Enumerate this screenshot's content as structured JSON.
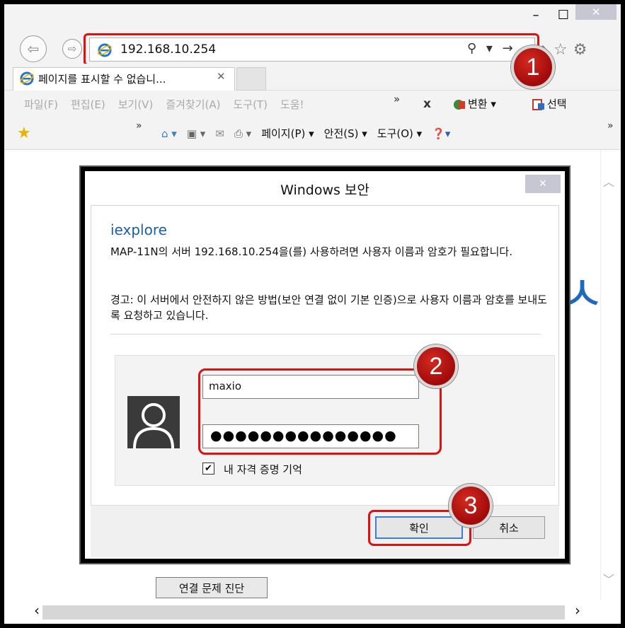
{
  "window": {
    "minimize_glyph": "–",
    "maximize_glyph": "☐",
    "close_glyph": "✕"
  },
  "addressbar": {
    "url": "192.168.10.254",
    "tools": "⚲ ▾ →"
  },
  "right_icons": "⌂☆⚙",
  "tab": {
    "title": "페이지를 표시할 수 없습니...",
    "close_glyph": "✕"
  },
  "menu": {
    "items": [
      "파일(F)",
      "편집(E)",
      "보기(V)",
      "즐겨찾기(A)",
      "도구(T)",
      "도움!"
    ],
    "more": "»",
    "x": "x",
    "convert": "변환 ▾",
    "select": "선택"
  },
  "commandbar": {
    "more": "»",
    "home": "⌂ ▾",
    "feeds": "▣ ▾",
    "mail": "✉",
    "print": "⎙ ▾",
    "page": "페이지(P) ▾",
    "safety": "안전(S) ▾",
    "tools": "도구(O) ▾",
    "help": "❓▾"
  },
  "background": {
    "glyph": "ㅅ|",
    "diagnose_button": "연결 문제 진단"
  },
  "dialog": {
    "title": "Windows 보안",
    "close_glyph": "✕",
    "app_name": "iexplore",
    "message": "MAP-11N의 서버 192.168.10.254을(를) 사용하려면 사용자 이름과 암호가 필요합니다.",
    "warning": "경고: 이 서버에서 안전하지 않은 방법(보안 연결 없이 기본 인증)으로 사용자 이름과 암호를 보내도록 요청하고 있습니다.",
    "username": "maxio",
    "password_mask": "●●●●●●●●●●●●●●●",
    "remember_label": "내 자격 증명 기억",
    "remember_checked": true,
    "ok_label": "확인",
    "cancel_label": "취소"
  },
  "callouts": [
    "1",
    "2",
    "3"
  ],
  "colors": {
    "highlight": "#e01010",
    "badge": "#c01818",
    "link_blue": "#1a5fa8"
  }
}
